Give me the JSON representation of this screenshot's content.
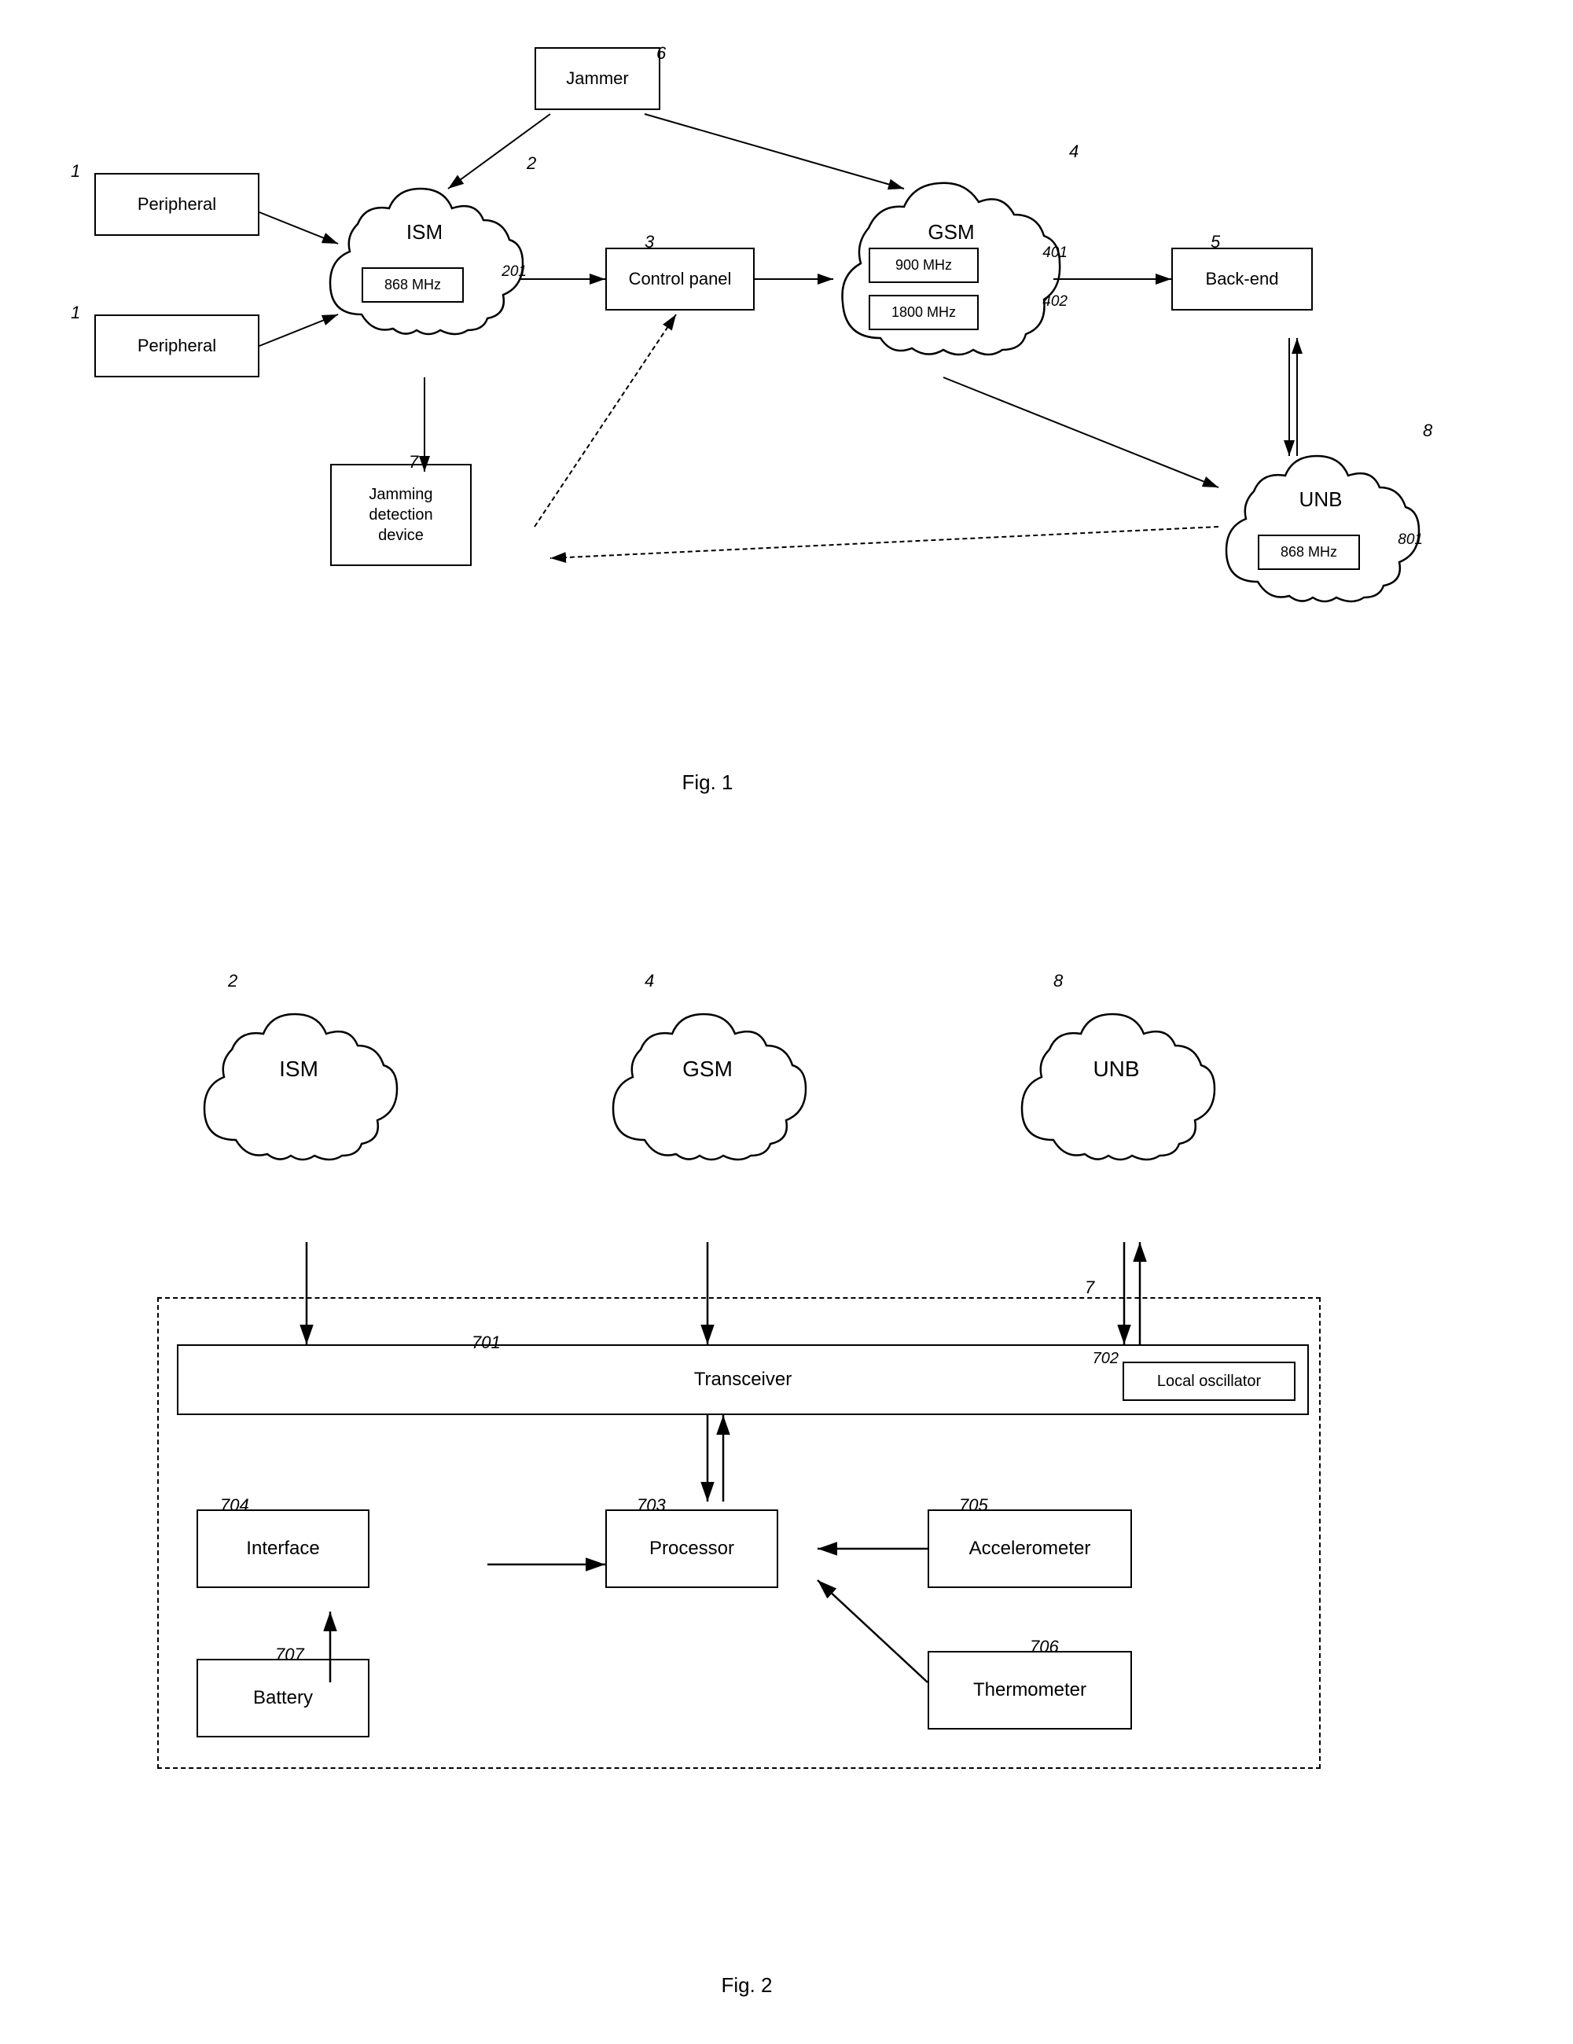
{
  "fig1": {
    "label": "Fig. 1",
    "nodes": {
      "peripheral1": {
        "label": "Peripheral",
        "ref": "1"
      },
      "peripheral2": {
        "label": "Peripheral",
        "ref": "1"
      },
      "ism_cloud": {
        "label": "ISM",
        "ref": "2"
      },
      "ism_inner": {
        "label": "868 MHz",
        "ref": "201"
      },
      "control_panel": {
        "label": "Control panel",
        "ref": "3"
      },
      "gsm_cloud": {
        "label": "GSM",
        "ref": "4"
      },
      "gsm_inner1": {
        "label": "900 MHz",
        "ref": "401"
      },
      "gsm_inner2": {
        "label": "1800 MHz",
        "ref": "402"
      },
      "backend": {
        "label": "Back-end",
        "ref": "5"
      },
      "jammer": {
        "label": "Jammer",
        "ref": "6"
      },
      "jamming": {
        "label": "Jamming\ndetection\ndevice",
        "ref": "7"
      },
      "unb_cloud": {
        "label": "UNB",
        "ref": "8"
      },
      "unb_inner": {
        "label": "868 MHz",
        "ref": "801"
      }
    }
  },
  "fig2": {
    "label": "Fig. 2",
    "nodes": {
      "ism_cloud": {
        "label": "ISM",
        "ref": "2"
      },
      "gsm_cloud": {
        "label": "GSM",
        "ref": "4"
      },
      "unb_cloud": {
        "label": "UNB",
        "ref": "8"
      },
      "transceiver": {
        "label": "Transceiver",
        "ref": "701"
      },
      "local_osc": {
        "label": "Local oscillator",
        "ref": "702"
      },
      "interface": {
        "label": "Interface",
        "ref": "704"
      },
      "processor": {
        "label": "Processor",
        "ref": "703"
      },
      "accelerometer": {
        "label": "Accelerometer",
        "ref": "705"
      },
      "battery": {
        "label": "Battery",
        "ref": "707"
      },
      "thermometer": {
        "label": "Thermometer",
        "ref": "706"
      },
      "device_ref": {
        "ref": "7"
      }
    }
  }
}
